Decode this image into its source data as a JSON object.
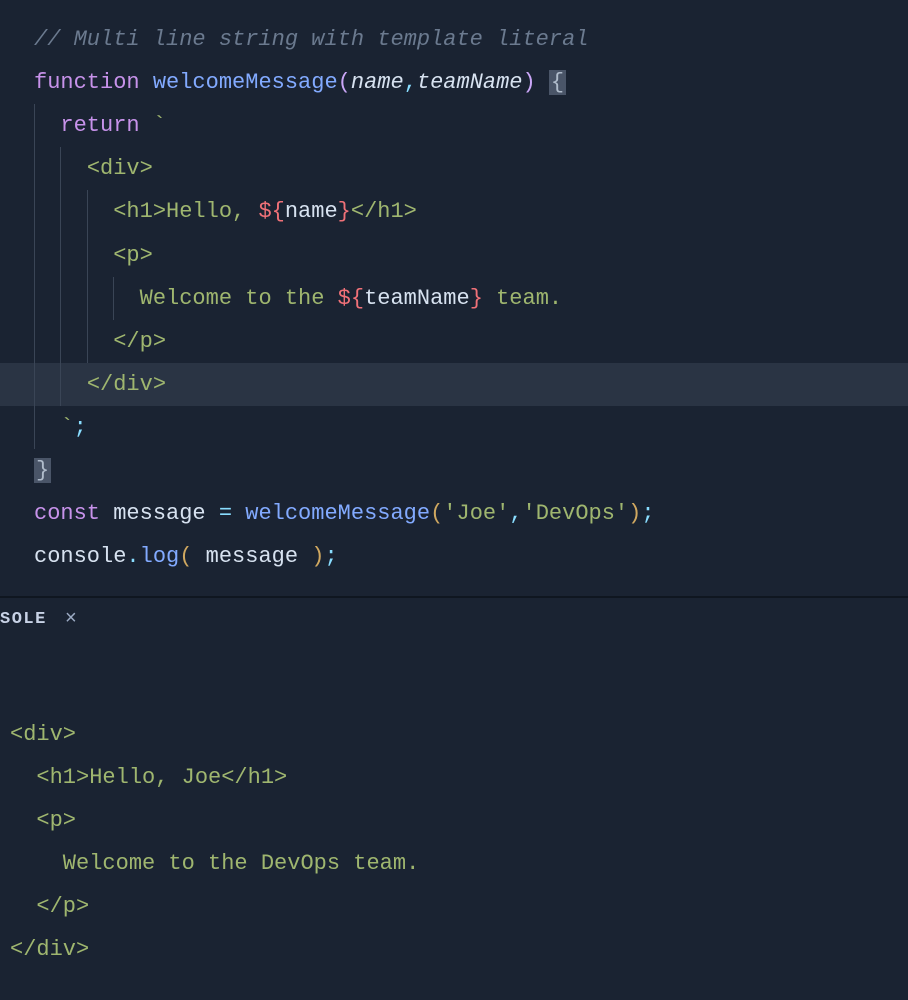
{
  "editor": {
    "lines": {
      "l1_comment": "// Multi line string with template literal",
      "l2_function": "function",
      "l2_funcName": "welcomeMessage",
      "l2_param1": "name",
      "l2_param2": "teamName",
      "l3_return": "return",
      "l4_divOpen": "<div>",
      "l5_h1Open": "<h1>",
      "l5_h1Text": "Hello, ",
      "l5_interpOpen": "${",
      "l5_interpVar": "name",
      "l5_interpClose": "}",
      "l5_h1Close": "</h1>",
      "l6_pOpen": "<p>",
      "l7_pText": "Welcome to the ",
      "l7_interpOpen": "${",
      "l7_interpVar": "teamName",
      "l7_interpClose": "}",
      "l7_tail": " team.",
      "l8_pClose": "</p>",
      "l9_divClose": "</div>",
      "l10_tick": "`",
      "l10_semi": ";",
      "l12_const": "const",
      "l12_var": "message",
      "l12_eq": "=",
      "l12_call": "welcomeMessage",
      "l12_arg1": "'Joe'",
      "l12_arg2": "'DevOps'",
      "l13_obj": "console",
      "l13_method": "log",
      "l13_arg": "message"
    }
  },
  "console": {
    "tabLabel": "SOLE",
    "output": "\n<div>\n  <h1>Hello, Joe</h1>\n  <p>\n    Welcome to the DevOps team.\n  </p>\n</div>"
  }
}
